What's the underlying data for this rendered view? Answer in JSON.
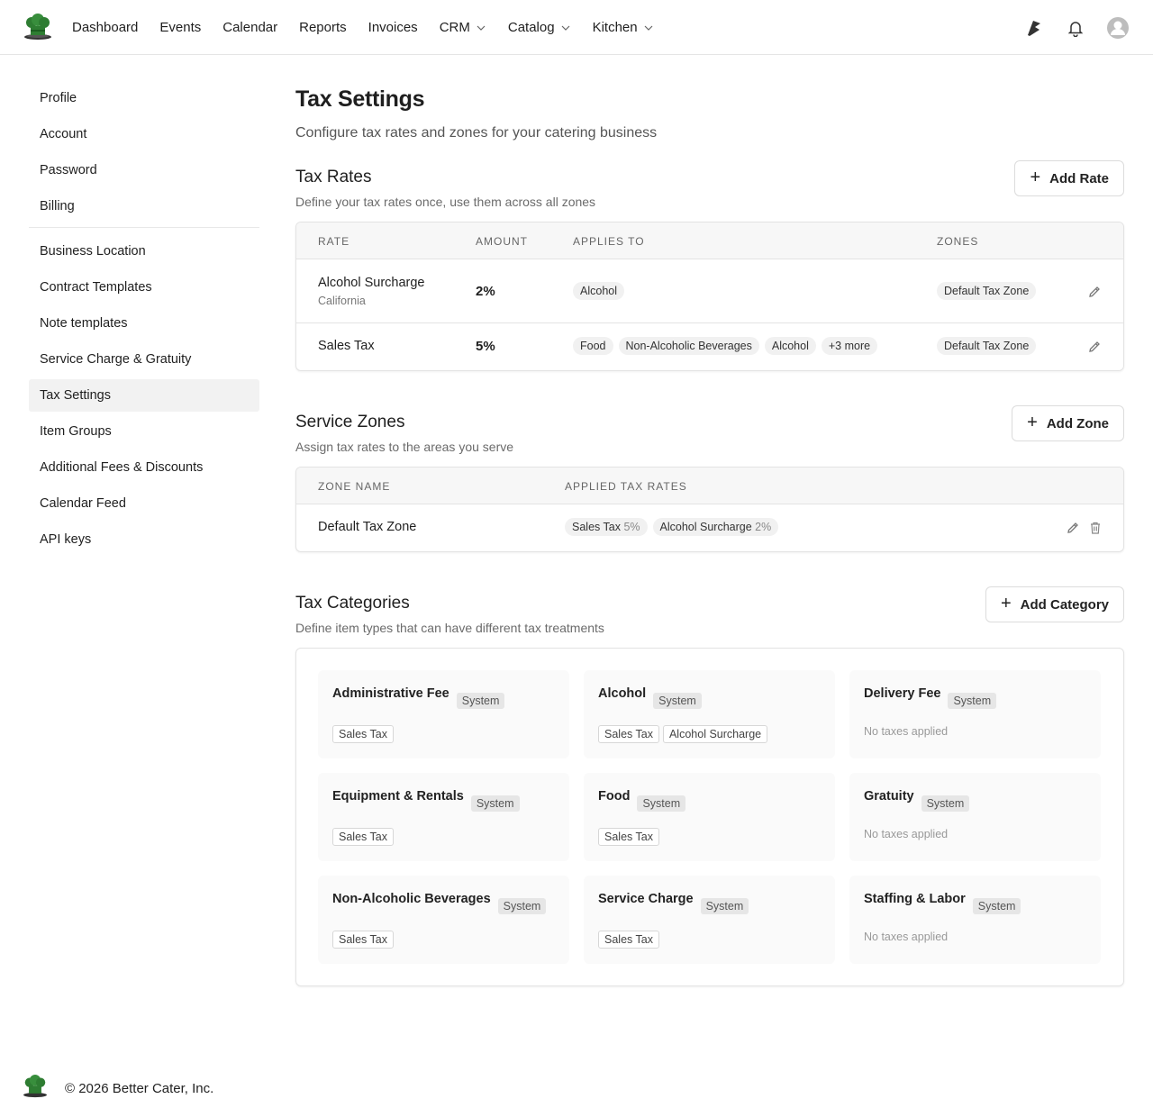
{
  "nav": {
    "items": [
      {
        "label": "Dashboard",
        "dropdown": false
      },
      {
        "label": "Events",
        "dropdown": false
      },
      {
        "label": "Calendar",
        "dropdown": false
      },
      {
        "label": "Reports",
        "dropdown": false
      },
      {
        "label": "Invoices",
        "dropdown": false
      },
      {
        "label": "CRM",
        "dropdown": true
      },
      {
        "label": "Catalog",
        "dropdown": true
      },
      {
        "label": "Kitchen",
        "dropdown": true
      }
    ]
  },
  "sidebar": {
    "group1": [
      "Profile",
      "Account",
      "Password",
      "Billing"
    ],
    "group2": [
      "Business Location",
      "Contract Templates",
      "Note templates",
      "Service Charge & Gratuity",
      "Tax Settings",
      "Item Groups",
      "Additional Fees & Discounts",
      "Calendar Feed",
      "API keys"
    ],
    "active": "Tax Settings"
  },
  "page": {
    "title": "Tax Settings",
    "subtitle": "Configure tax rates and zones for your catering business"
  },
  "tax_rates": {
    "title": "Tax Rates",
    "subtitle": "Define your tax rates once, use them across all zones",
    "add_label": "Add Rate",
    "columns": {
      "rate": "RATE",
      "amount": "AMOUNT",
      "applies": "APPLIES TO",
      "zones": "ZONES"
    },
    "rows": [
      {
        "name": "Alcohol Surcharge",
        "sub": "California",
        "amount": "2%",
        "applies": [
          "Alcohol"
        ],
        "zones": [
          "Default Tax Zone"
        ]
      },
      {
        "name": "Sales Tax",
        "sub": "",
        "amount": "5%",
        "applies": [
          "Food",
          "Non-Alcoholic Beverages",
          "Alcohol",
          "+3 more"
        ],
        "zones": [
          "Default Tax Zone"
        ]
      }
    ]
  },
  "service_zones": {
    "title": "Service Zones",
    "subtitle": "Assign tax rates to the areas you serve",
    "add_label": "Add Zone",
    "columns": {
      "zone": "ZONE NAME",
      "rates": "APPLIED TAX RATES"
    },
    "rows": [
      {
        "name": "Default Tax Zone",
        "rates": [
          {
            "name": "Sales Tax",
            "pct": "5%"
          },
          {
            "name": "Alcohol Surcharge",
            "pct": "2%"
          }
        ]
      }
    ]
  },
  "tax_categories": {
    "title": "Tax Categories",
    "subtitle": "Define item types that can have different tax treatments",
    "add_label": "Add Category",
    "system_label": "System",
    "no_tax_label": "No taxes applied",
    "items": [
      {
        "name": "Administrative Fee",
        "taxes": [
          "Sales Tax"
        ]
      },
      {
        "name": "Alcohol",
        "taxes": [
          "Sales Tax",
          "Alcohol Surcharge"
        ]
      },
      {
        "name": "Delivery Fee",
        "taxes": []
      },
      {
        "name": "Equipment & Rentals",
        "taxes": [
          "Sales Tax"
        ]
      },
      {
        "name": "Food",
        "taxes": [
          "Sales Tax"
        ]
      },
      {
        "name": "Gratuity",
        "taxes": []
      },
      {
        "name": "Non-Alcoholic Beverages",
        "taxes": [
          "Sales Tax"
        ]
      },
      {
        "name": "Service Charge",
        "taxes": [
          "Sales Tax"
        ]
      },
      {
        "name": "Staffing & Labor",
        "taxes": []
      }
    ]
  },
  "footer": {
    "text": "© 2026 Better Cater, Inc."
  },
  "icons": {
    "logo": "chef-hat-logo-icon",
    "brand_color": "#2e7d32"
  }
}
